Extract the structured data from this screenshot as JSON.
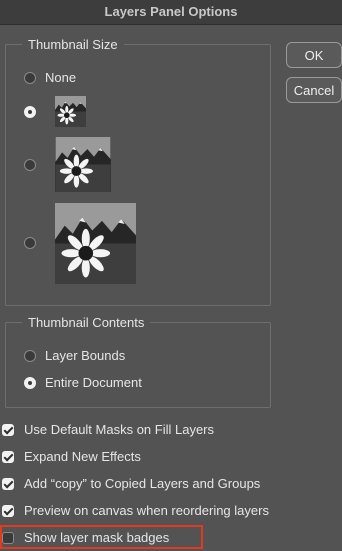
{
  "dialog": {
    "title": "Layers Panel Options",
    "ok_label": "OK",
    "cancel_label": "Cancel"
  },
  "thumbnail_size": {
    "title": "Thumbnail Size",
    "options": [
      {
        "label": "None",
        "selected": false
      },
      {
        "label": "Small",
        "selected": true
      },
      {
        "label": "Medium",
        "selected": false
      },
      {
        "label": "Large",
        "selected": false
      }
    ]
  },
  "thumbnail_contents": {
    "title": "Thumbnail Contents",
    "options": [
      {
        "label": "Layer Bounds",
        "selected": false
      },
      {
        "label": "Entire Document",
        "selected": true
      }
    ]
  },
  "checkboxes": [
    {
      "label": "Use Default Masks on Fill Layers",
      "checked": true
    },
    {
      "label": "Expand New Effects",
      "checked": true
    },
    {
      "label": "Add “copy” to Copied Layers and Groups",
      "checked": true
    },
    {
      "label": "Preview on canvas when reordering layers",
      "checked": true
    },
    {
      "label": "Show layer mask badges",
      "checked": false
    }
  ],
  "highlight_color": "#e03a1f"
}
